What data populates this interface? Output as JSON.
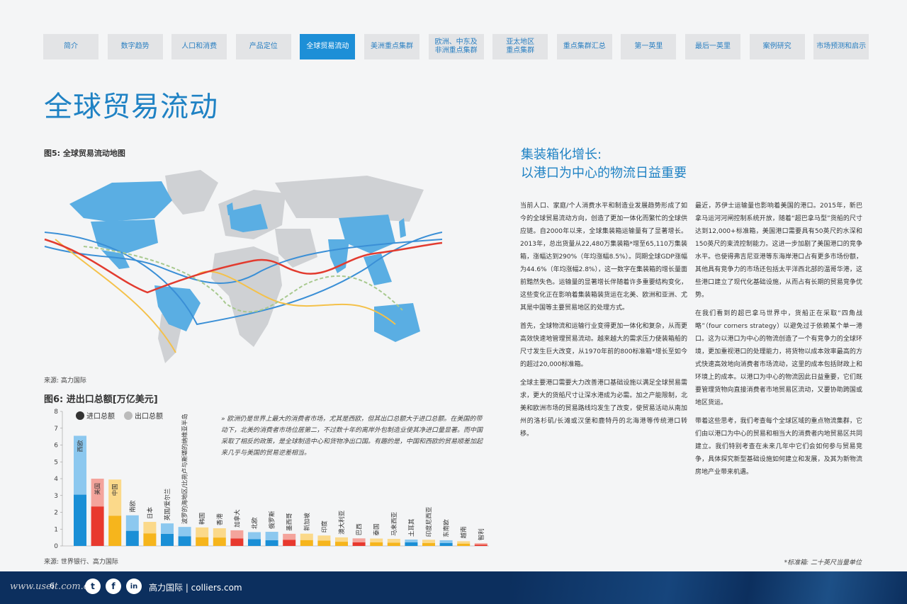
{
  "nav": {
    "tabs": [
      "简介",
      "数字趋势",
      "人口和消费",
      "产品定位",
      "全球贸易流动",
      "美洲重点集群",
      "欧洲、中东及\n非洲重点集群",
      "亚太地区\n重点集群",
      "重点集群汇总",
      "第一英里",
      "最后一英里",
      "案例研究",
      "市场预测和启示"
    ],
    "active_index": 4
  },
  "page_title": "全球贸易流动",
  "figure5": {
    "label": "图5: 全球贸易流动地图",
    "source": "来源: 高力国际"
  },
  "figure6": {
    "label": "图6: 进出口总额[万亿美元]",
    "source": "来源: 世界银行、高力国际"
  },
  "quote": "» 欧洲仍是世界上最大的消费者市场，尤其是西欧，但其出口总额大于进口总额。在美国的带动下，北美的消费者市场位居第二，不过数十年的离岸外包制造业使其净进口量显著。而中国采取了相反的政策，是全球制造中心和货物净出口国。有趣的是，中国和西欧的贸易顺差加起来几乎与美国的贸易逆差相当。",
  "chart_data": {
    "type": "bar",
    "title": "进出口总额[万亿美元]",
    "ylim": [
      0,
      8
    ],
    "yticks": [
      "0",
      "1",
      "2",
      "3",
      "4",
      "5",
      "6",
      "7",
      "8"
    ],
    "legend": [
      {
        "name": "进口总额",
        "color": "#333333"
      },
      {
        "name": "出口总额",
        "color": "#bbbbbb"
      }
    ],
    "categories": [
      "西欧",
      "美国",
      "中国",
      "南欧",
      "日本",
      "英国/爱尔兰",
      "波罗的海地区/比荷卢与斯堪的纳维亚半岛",
      "韩国",
      "香港",
      "加拿大",
      "北欧",
      "俄罗斯",
      "墨西哥",
      "新加坡",
      "印度",
      "澳大利亚",
      "巴西",
      "泰国",
      "马来西亚",
      "土耳其",
      "印度尼西亚",
      "东南欧",
      "越南",
      "智利"
    ],
    "series": [
      {
        "name": "进口总额",
        "values": [
          3.05,
          2.35,
          1.8,
          0.9,
          0.75,
          0.72,
          0.58,
          0.52,
          0.5,
          0.45,
          0.4,
          0.34,
          0.37,
          0.35,
          0.32,
          0.25,
          0.22,
          0.22,
          0.2,
          0.22,
          0.18,
          0.18,
          0.14,
          0.08
        ]
      },
      {
        "name": "出口总额",
        "values": [
          3.5,
          1.65,
          2.15,
          0.92,
          0.68,
          0.62,
          0.55,
          0.58,
          0.55,
          0.48,
          0.42,
          0.5,
          0.35,
          0.38,
          0.3,
          0.26,
          0.23,
          0.22,
          0.22,
          0.16,
          0.19,
          0.16,
          0.14,
          0.08
        ]
      }
    ],
    "bar_colors": [
      [
        "#1a8fd6",
        "#8cc8ef"
      ],
      [
        "#e8392e",
        "#f4a49c"
      ],
      [
        "#f6b51c",
        "#fbd98a"
      ],
      [
        "#1a8fd6",
        "#8cc8ef"
      ],
      [
        "#f6b51c",
        "#fbd98a"
      ],
      [
        "#1a8fd6",
        "#8cc8ef"
      ],
      [
        "#1a8fd6",
        "#8cc8ef"
      ],
      [
        "#f6b51c",
        "#fbd98a"
      ],
      [
        "#f6b51c",
        "#fbd98a"
      ],
      [
        "#e8392e",
        "#f4a49c"
      ],
      [
        "#1a8fd6",
        "#8cc8ef"
      ],
      [
        "#1a8fd6",
        "#8cc8ef"
      ],
      [
        "#e8392e",
        "#f4a49c"
      ],
      [
        "#f6b51c",
        "#fbd98a"
      ],
      [
        "#f6b51c",
        "#fbd98a"
      ],
      [
        "#f6b51c",
        "#fbd98a"
      ],
      [
        "#e8392e",
        "#f4a49c"
      ],
      [
        "#f6b51c",
        "#fbd98a"
      ],
      [
        "#f6b51c",
        "#fbd98a"
      ],
      [
        "#1a8fd6",
        "#8cc8ef"
      ],
      [
        "#f6b51c",
        "#fbd98a"
      ],
      [
        "#1a8fd6",
        "#8cc8ef"
      ],
      [
        "#f6b51c",
        "#fbd98a"
      ],
      [
        "#e8392e",
        "#f4a49c"
      ]
    ]
  },
  "section": {
    "title_line1": "集装箱化增长:",
    "title_line2": "以港口为中心的物流日益重要"
  },
  "column1": [
    "当前人口、家庭/个人消费水平和制造业发展趋势形成了如今的全球贸易流动方向，创造了更加一体化而繁忙的全球供应链。自2000年以来，全球集装箱运输量有了显著增长。2013年，总出货量从22,480万集装箱*增至65,110万集装箱，涨幅达到290%（年均涨幅8.5%）。同期全球GDP涨幅为44.6%（年均涨幅2.8%），这一数字在集装箱的增长量面前黯然失色。运输量的显著增长伴随着许多重要结构变化，这些变化正在影响着集装箱装货运在北美、欧洲和亚洲、尤其是中国等主要贸易地区的处理方式。",
    "首先，全球物流和运输行业变得更加一体化和复杂，从而更高效快速地管理贸易流动。越来越大的需求压力使装箱船的尺寸发生巨大改变，从1970年前的800标准箱*增长至如今的超过20,000标准箱。",
    "全球主要港口需要大力改善港口基础设施以满足全球贸易需求，更大的货船尺寸让深水港成为必需。加之产能限制，北美和欧洲市场的贸易路线均发生了改变，使贸易活动从南加州的洛杉矶/长滩或汉堡和鹿特丹的北海港等传统港口转移。"
  ],
  "column2": [
    "最近，苏伊士运输量也影响着美国的港口。2015年，新巴拿马运河河闸控制系统开放，随着“超巴拿马型”货船的尺寸达到12,000+标准箱，美国港口需要具有50英尺的水深和150英尺的束流控制能力。这进一步加剧了美国港口的竞争水平。也使得弗吉尼亚港等东海岸港口占有更多市场份额，其他具有竞争力的市场还包括太平洋西北部的温哥华港，这些港口建立了现代化基础设施，从而占有长期的贸易竞争优势。",
    "在我们看到的超巴拿马世界中，货船正在采取“四角战略”（four corners strategy）以避免过于依赖某个单一港口。这为以港口为中心的物流创造了一个有竞争力的全球环境，更加重视港口的处理能力，将货物以成本效率最高的方式快速高效地向消费者市场流动，这里的成本包括财政上和环境上的成本。以港口为中心的物流因此日益重要，它们既要管理货物向直接消费者市地贸易区流动，又要协助跨国或地区货运。",
    "带着这些思考，我们考查每个全球区域的重点物流集群，它们由以港口为中心的贸易和相当大的消费者内地贸易区共同建立。我们特别考查在未来几年中它们会如何参与贸易竞争，具体探究新型基础设施如何建立和发展，及其为新物流房地产业带来机遇。"
  ],
  "footnote": "*标准箱: 二十英尺当量单位",
  "footer": {
    "watermark": "www.useit.com.cn",
    "page_number": "6",
    "brand": "高力国际 | colliers.com",
    "icons": [
      "twitter-icon",
      "facebook-icon",
      "linkedin-icon"
    ],
    "icon_glyphs": [
      "t",
      "f",
      "in"
    ]
  }
}
